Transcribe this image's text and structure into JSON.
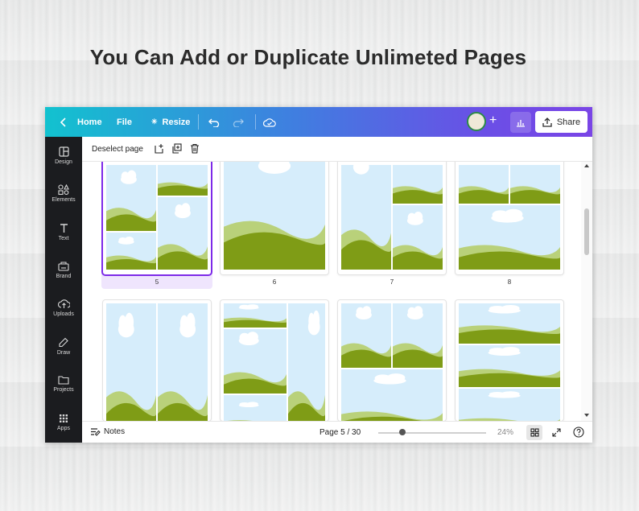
{
  "headline": "You Can Add or Duplicate Unlimeted Pages",
  "topbar": {
    "home_label": "Home",
    "file_label": "File",
    "resize_label": "Resize",
    "share_label": "Share"
  },
  "sidebar": {
    "items": [
      {
        "label": "Design",
        "icon": "layout-icon"
      },
      {
        "label": "Elements",
        "icon": "shapes-icon"
      },
      {
        "label": "Text",
        "icon": "text-icon"
      },
      {
        "label": "Brand",
        "icon": "brand-icon"
      },
      {
        "label": "Uploads",
        "icon": "cloud-upload-icon"
      },
      {
        "label": "Draw",
        "icon": "pen-icon"
      },
      {
        "label": "Projects",
        "icon": "folder-icon"
      },
      {
        "label": "Apps",
        "icon": "grid-icon"
      }
    ]
  },
  "toolbar": {
    "deselect_label": "Deselect page"
  },
  "pages": [
    {
      "number": "5",
      "selected": true
    },
    {
      "number": "6",
      "selected": false
    },
    {
      "number": "7",
      "selected": false
    },
    {
      "number": "8",
      "selected": false
    }
  ],
  "bottombar": {
    "notes_label": "Notes",
    "page_indicator": "Page 5 / 30",
    "zoom_label": "24%"
  },
  "colors": {
    "sky": "#d6edfb",
    "grass_dark": "#7f9c16",
    "grass_light": "#b9d17a",
    "cloud": "#ffffff",
    "accent": "#7d2ae8"
  }
}
